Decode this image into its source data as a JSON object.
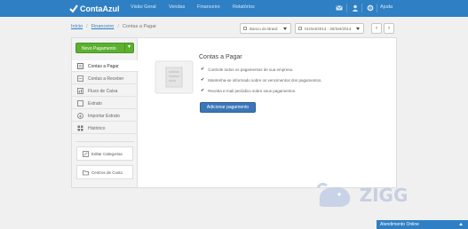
{
  "app": {
    "logo_text": "ContaAzul"
  },
  "topnav": {
    "items": [
      "Visão Geral",
      "Vendas",
      "Financeiro",
      "Relatórios"
    ],
    "help_label": "Ajuda"
  },
  "breadcrumb": {
    "home": "Início",
    "section": "Financeiro",
    "current": "Contas a Pagar"
  },
  "filters": {
    "account_select": "Banco do Brasil",
    "period_select": "01/Set/2014 - 30/Set/2014",
    "prev_label": "‹",
    "next_label": "›"
  },
  "sidebar": {
    "new_button": "Novo Pagamento",
    "new_button_caret": "▾",
    "items": [
      {
        "label": "Contas a Pagar",
        "icon": "list-icon"
      },
      {
        "label": "Contas a Receber",
        "icon": "receivable-icon"
      },
      {
        "label": "Fluxo de Caixa",
        "icon": "cashflow-icon"
      },
      {
        "label": "Extrato",
        "icon": "statement-icon"
      },
      {
        "label": "Importar Extrato",
        "icon": "import-icon"
      },
      {
        "label": "Histórico",
        "icon": "history-icon"
      }
    ],
    "boxes": [
      {
        "label": "Editar Categorias",
        "icon": "edit-icon"
      },
      {
        "label": "Centros de Custo",
        "icon": "folder-icon"
      }
    ]
  },
  "content": {
    "title": "Contas a Pagar",
    "checks": [
      "Controle todos os pagamentos de sua empresa.",
      "Mantenha-se informado sobre os vencimentos dos pagamentos.",
      "Receba e-mail periódico sobre seus pagamentos."
    ],
    "check_mark": "✔",
    "cta": "Adicionar pagamento"
  },
  "watermark": {
    "text": "ZIGG"
  },
  "chat": {
    "label": "Atendimento Online"
  },
  "colors": {
    "brand": "#2f7fc4",
    "green": "#5cb030",
    "cta": "#3b76b8"
  }
}
